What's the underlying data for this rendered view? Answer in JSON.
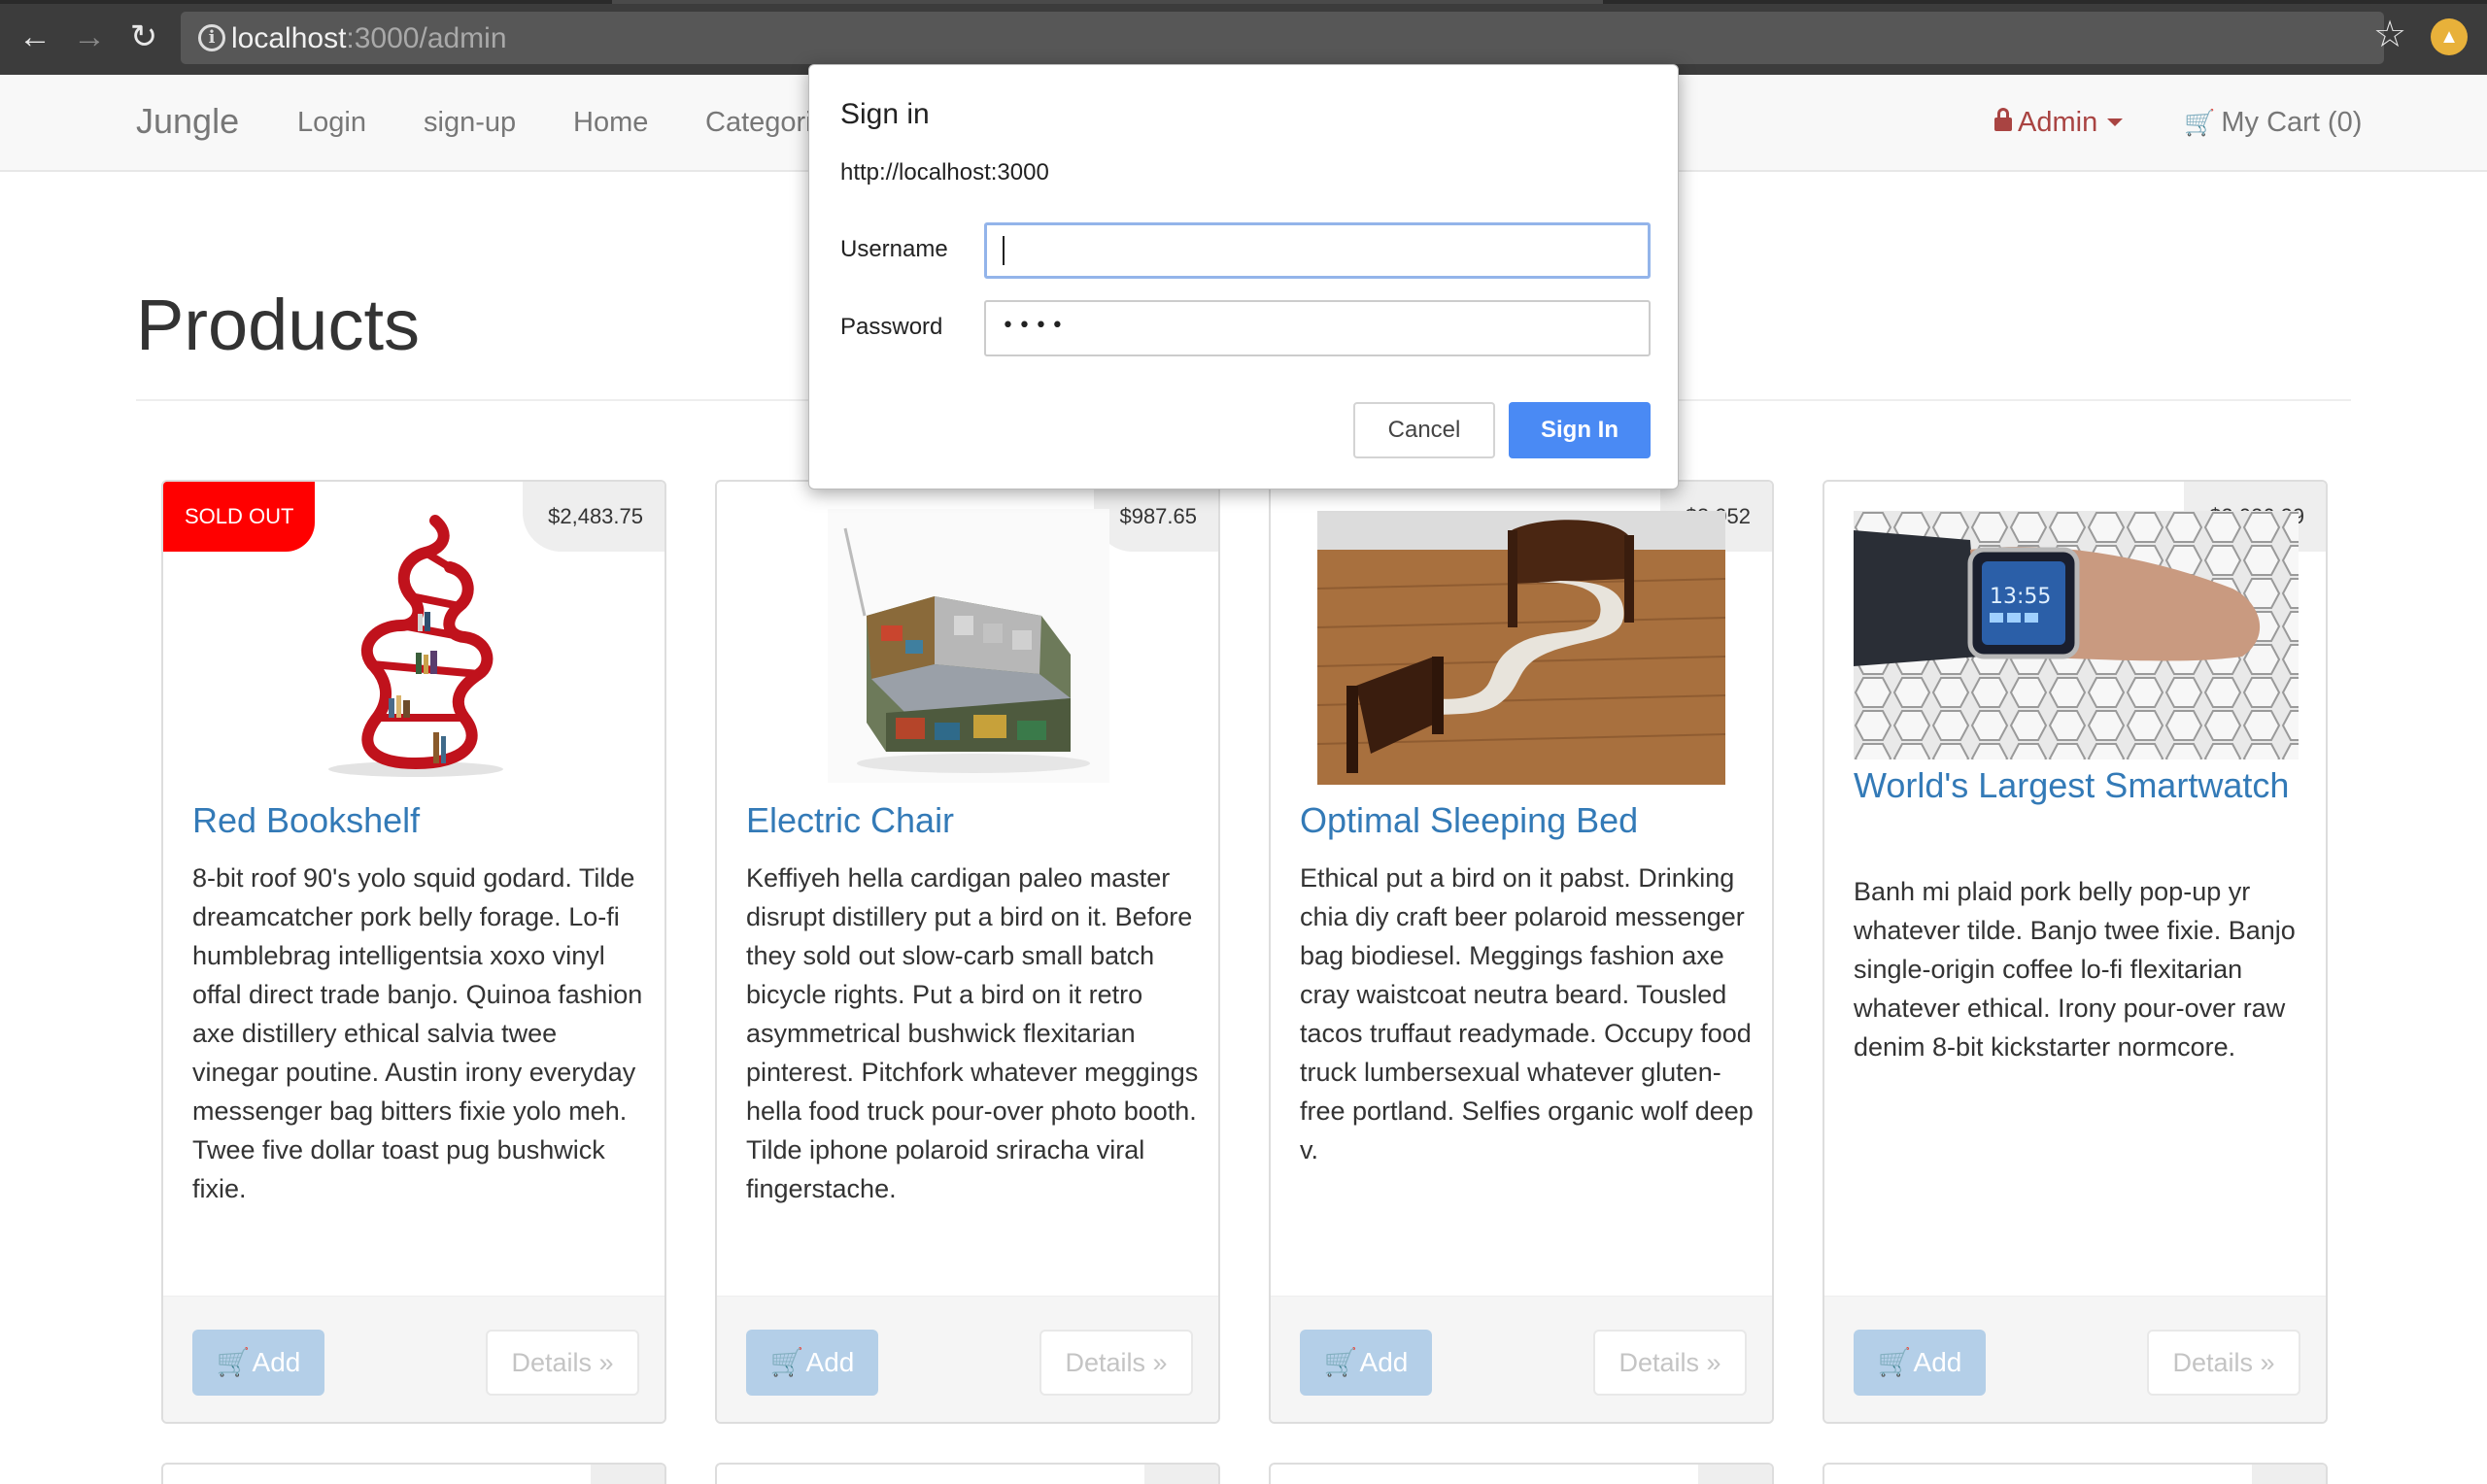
{
  "browser": {
    "url_host": "localhost",
    "url_rest": ":3000/admin",
    "back_icon": "back-arrow-icon",
    "forward_icon": "forward-arrow-icon",
    "reload_icon": "reload-icon"
  },
  "navbar": {
    "brand": "Jungle",
    "links": [
      "Login",
      "sign-up",
      "Home",
      "Categori"
    ],
    "admin_label": "Admin",
    "cart_label": "My Cart (0)"
  },
  "page": {
    "title": "Products"
  },
  "products": [
    {
      "name": "Red Bookshelf",
      "price": "$2,483.75",
      "badge": "SOLD OUT",
      "description": "8-bit roof 90's yolo squid godard. Tilde dreamcatcher pork belly forage. Lo-fi humblebrag intelligentsia xoxo vinyl offal direct trade banjo. Quinoa fashion axe distillery ethical salvia twee vinegar poutine. Austin irony everyday messenger bag bitters fixie yolo meh. Twee five dollar toast pug bushwick fixie.",
      "add_label": "Add",
      "details_label": "Details »"
    },
    {
      "name": "Electric Chair",
      "price": "$987.65",
      "description": "Keffiyeh hella cardigan paleo master disrupt distillery put a bird on it. Before they sold out slow-carb small batch bicycle rights. Put a bird on it retro asymmetrical bushwick flexitarian pinterest. Pitchfork whatever meggings hella food truck pour-over photo booth. Tilde iphone polaroid sriracha viral fingerstache.",
      "add_label": "Add",
      "details_label": "Details »"
    },
    {
      "name": "Optimal Sleeping Bed",
      "price": "$3,052",
      "description": "Ethical put a bird on it pabst. Drinking chia diy craft beer polaroid messenger bag biodiesel. Meggings fashion axe cray waistcoat neutra beard. Tousled tacos truffaut readymade. Occupy food truck lumbersexual whatever gluten-free portland. Selfies organic wolf deep v.",
      "add_label": "Add",
      "details_label": "Details »"
    },
    {
      "name": "World's Largest Smartwatch",
      "price": "$2,026.29",
      "description": "Banh mi plaid pork belly pop-up yr whatever tilde. Banjo twee fixie. Banjo single-origin coffee lo-fi flexitarian whatever ethical. Irony pour-over raw denim 8-bit kickstarter normcore.",
      "add_label": "Add",
      "details_label": "Details »"
    }
  ],
  "dialog": {
    "title": "Sign in",
    "origin": "http://localhost:3000",
    "username_label": "Username",
    "username_value": "",
    "password_label": "Password",
    "password_value": "••••",
    "cancel_label": "Cancel",
    "signin_label": "Sign In"
  },
  "colors": {
    "link_blue": "#337ab7",
    "sold_out_red": "#ff0000",
    "admin_red": "#a94442",
    "sign_in_blue": "#4a8af4"
  }
}
